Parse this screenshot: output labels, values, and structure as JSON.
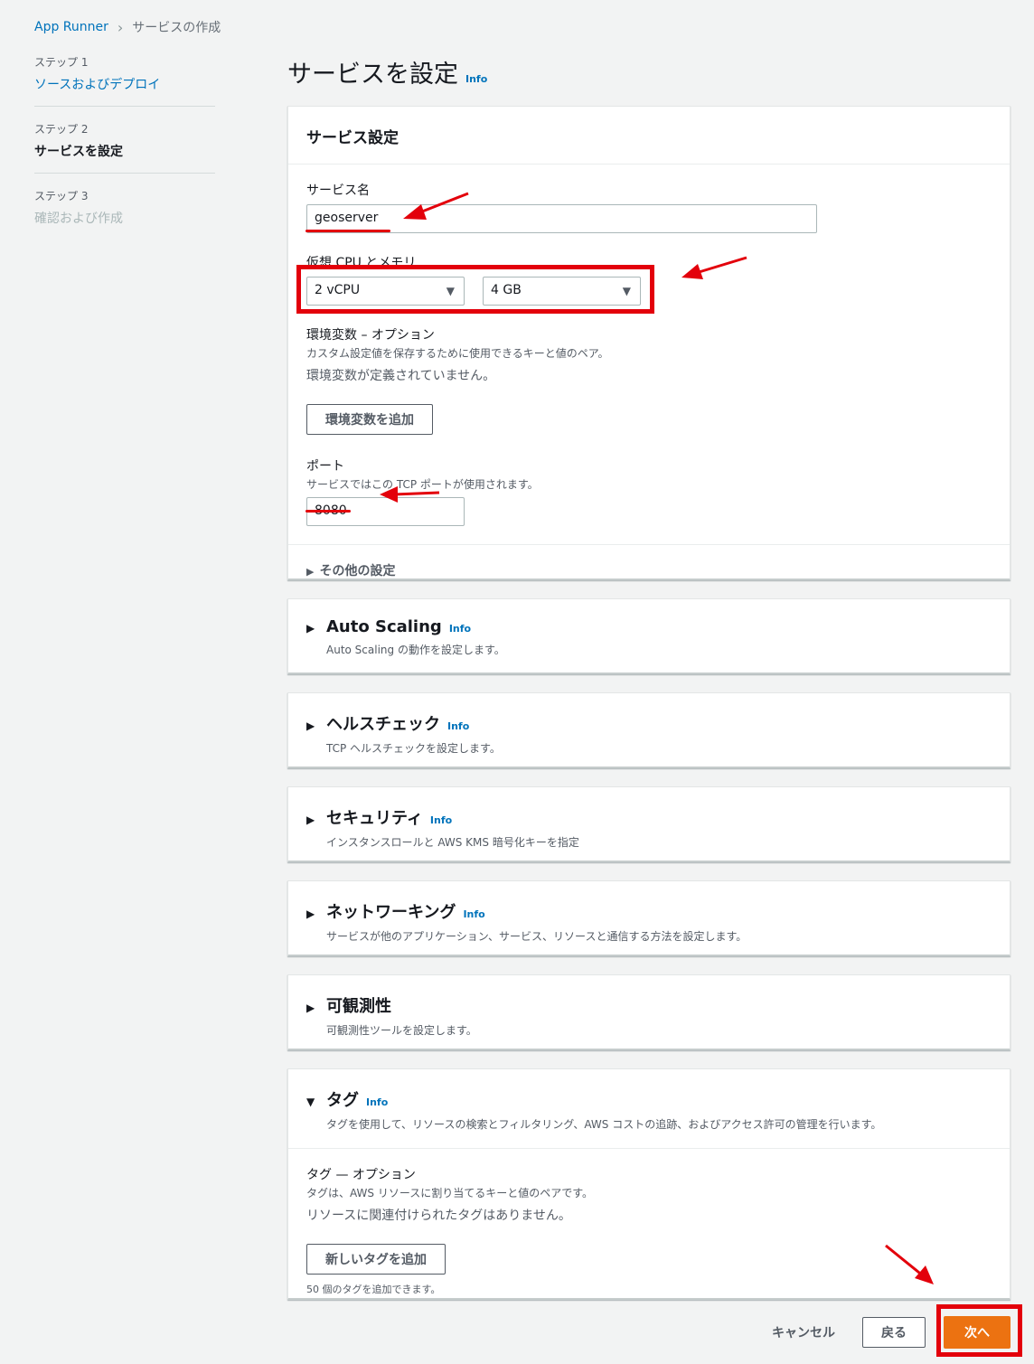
{
  "breadcrumb": {
    "root": "App Runner",
    "current": "サービスの作成"
  },
  "steps": [
    {
      "num": "ステップ 1",
      "title": "ソースおよびデプロイ"
    },
    {
      "num": "ステップ 2",
      "title": "サービスを設定"
    },
    {
      "num": "ステップ 3",
      "title": "確認および作成"
    }
  ],
  "page": {
    "title": "サービスを設定",
    "info": "Info"
  },
  "service_settings": {
    "header": "サービス設定",
    "name_label": "サービス名",
    "name_value": "geoserver",
    "cpu_mem_label": "仮想 CPU とメモリ",
    "cpu_value": "2 vCPU",
    "memory_value": "4 GB",
    "env_label": "環境変数 – オプション",
    "env_desc": "カスタム設定値を保存するために使用できるキーと値のペア。",
    "env_empty": "環境変数が定義されていません。",
    "env_add": "環境変数を追加",
    "port_label": "ポート",
    "port_desc": "サービスではこの TCP ポートが使用されます。",
    "port_value": "8080",
    "other": "その他の設定"
  },
  "sections": [
    {
      "title": "Auto Scaling",
      "info": "Info",
      "desc": "Auto Scaling の動作を設定します。"
    },
    {
      "title": "ヘルスチェック",
      "info": "Info",
      "desc": "TCP ヘルスチェックを設定します。"
    },
    {
      "title": "セキュリティ",
      "info": "Info",
      "desc": "インスタンスロールと AWS KMS 暗号化キーを指定"
    },
    {
      "title": "ネットワーキング",
      "info": "Info",
      "desc": "サービスが他のアプリケーション、サービス、リソースと通信する方法を設定します。"
    },
    {
      "title": "可観測性",
      "info": "",
      "desc": "可観測性ツールを設定します。"
    }
  ],
  "tags": {
    "title": "タグ",
    "info": "Info",
    "desc": "タグを使用して、リソースの検索とフィルタリング、AWS コストの追跡、およびアクセス許可の管理を行います。",
    "label": "タグ — オプション",
    "sub": "タグは、AWS リソースに割り当てるキーと値のペアです。",
    "empty": "リソースに関連付けられたタグはありません。",
    "add": "新しいタグを追加",
    "hint": "50 個のタグを追加できます。"
  },
  "footer": {
    "cancel": "キャンセル",
    "back": "戻る",
    "next": "次へ"
  },
  "colors": {
    "accent": "#0073bb",
    "primary": "#ec7211",
    "annotation": "#e3000b"
  }
}
